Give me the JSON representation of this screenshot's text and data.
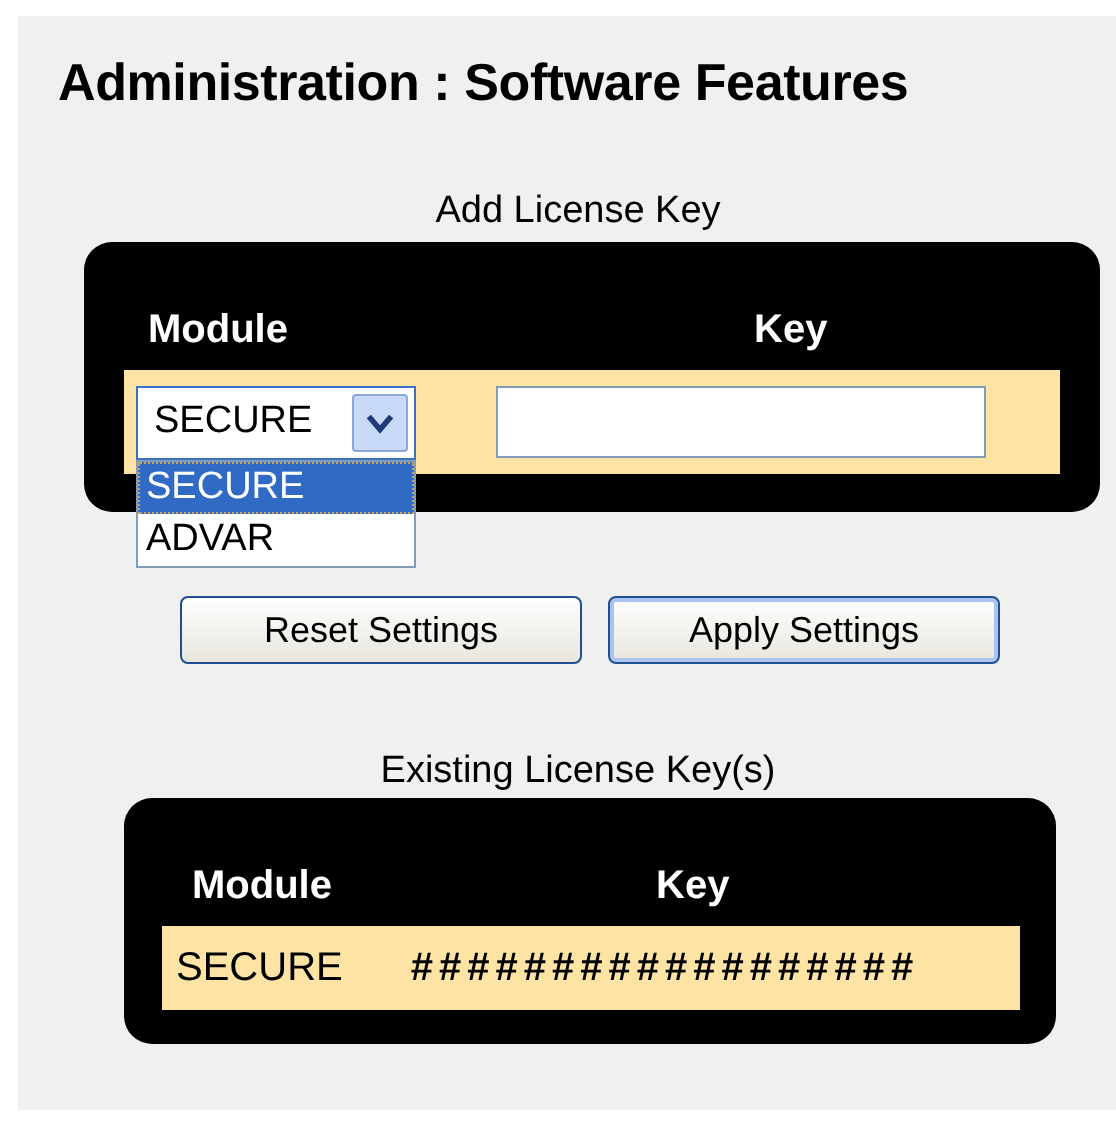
{
  "page_title": "Administration : Software Features",
  "add_section": {
    "title": "Add License Key",
    "columns": [
      "Module",
      "Key"
    ],
    "module_select": {
      "value": "SECURE",
      "expanded": true,
      "options": [
        {
          "label": "SECURE",
          "selected": true
        },
        {
          "label": "ADVAR",
          "selected": false
        }
      ]
    }
  },
  "buttons": [
    {
      "label": "Reset Settings",
      "focused": false
    },
    {
      "label": "Apply Settings",
      "focused": true
    }
  ],
  "existing_section": {
    "title": "Existing License Key(s)",
    "columns": [
      "Module",
      "Key"
    ],
    "rows": [
      {
        "module": "SECURE",
        "key": "##################"
      }
    ]
  }
}
